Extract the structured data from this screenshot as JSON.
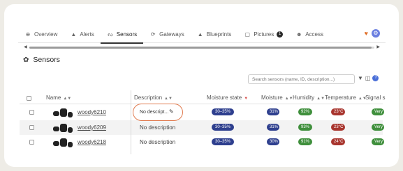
{
  "tabs": [
    {
      "label": "Overview",
      "icon": "globe-icon",
      "glyph": "⊕"
    },
    {
      "label": "Alerts",
      "icon": "warning-icon",
      "glyph": "▲"
    },
    {
      "label": "Sensors",
      "icon": "sensor-icon",
      "glyph": "ᔓ"
    },
    {
      "label": "Gateways",
      "icon": "gateway-icon",
      "glyph": "⟳"
    },
    {
      "label": "Blueprints",
      "icon": "blueprint-icon",
      "glyph": "▲"
    },
    {
      "label": "Pictures",
      "icon": "picture-icon",
      "glyph": "▢",
      "badge": "1"
    },
    {
      "label": "Access",
      "icon": "users-icon",
      "glyph": "👥"
    }
  ],
  "active_tab": "Sensors",
  "page_title": "Sensors",
  "search": {
    "placeholder": "Search sensors (name, ID, description...)"
  },
  "columns": {
    "name": "Name",
    "description": "Description",
    "moisture_state": "Moisture state",
    "moisture": "Moisture",
    "humidity": "Humidity",
    "temperature": "Temperature",
    "signal": "Signal s"
  },
  "rows": [
    {
      "name": "woody6210",
      "description": "No descript...",
      "moisture_state": "30–35%",
      "moisture": "31%",
      "humidity": "92%",
      "temperature": "23°C",
      "signal": "Very"
    },
    {
      "name": "woody6209",
      "description": "No description",
      "moisture_state": "30–35%",
      "moisture": "31%",
      "humidity": "93%",
      "temperature": "23°C",
      "signal": "Very"
    },
    {
      "name": "woody6218",
      "description": "No description",
      "moisture_state": "30–35%",
      "moisture": "30%",
      "humidity": "91%",
      "temperature": "24°C",
      "signal": "Very"
    }
  ],
  "colors": {
    "accent_edit": "#e07a4e",
    "pill_blue": "#2e3f8e",
    "pill_green": "#3f8f3c",
    "pill_red": "#a8352e"
  }
}
